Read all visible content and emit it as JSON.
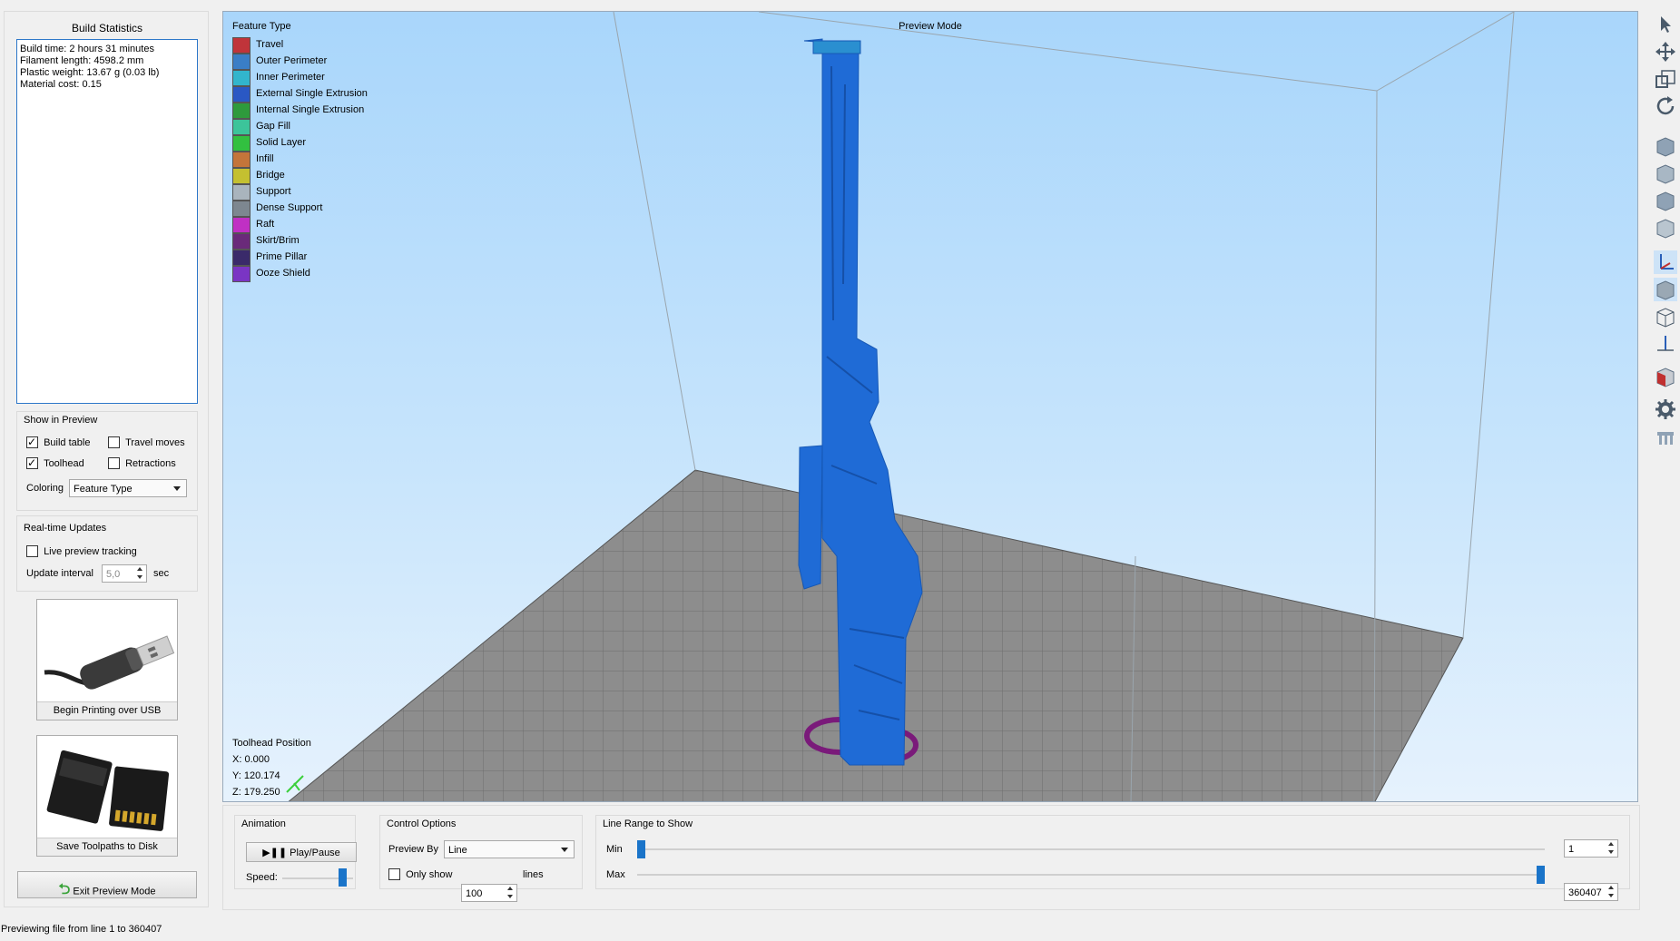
{
  "build_stats": {
    "title": "Build Statistics",
    "lines": [
      "Build time: 2 hours 31 minutes",
      "Filament length: 4598.2 mm",
      "Plastic weight: 13.67 g (0.03 lb)",
      "Material cost: 0.15"
    ]
  },
  "show_in_preview": {
    "title": "Show in Preview",
    "build_table": "Build table",
    "travel_moves": "Travel moves",
    "toolhead": "Toolhead",
    "retractions": "Retractions",
    "coloring_label": "Coloring",
    "coloring_value": "Feature Type"
  },
  "realtime": {
    "title": "Real-time Updates",
    "live_tracking": "Live preview tracking",
    "interval_label": "Update interval",
    "interval_value": "5,0",
    "interval_unit": "sec"
  },
  "actions": {
    "usb_label": "Begin Printing over USB",
    "disk_label": "Save Toolpaths to Disk",
    "exit_label": "Exit Preview Mode"
  },
  "viewport": {
    "mode_title": "Preview Mode",
    "legend_title": "Feature Type",
    "legend": [
      {
        "label": "Travel",
        "color": "#c0343a"
      },
      {
        "label": "Outer Perimeter",
        "color": "#3a7ec6"
      },
      {
        "label": "Inner Perimeter",
        "color": "#32b5cc"
      },
      {
        "label": "External Single Extrusion",
        "color": "#2a58c4"
      },
      {
        "label": "Internal Single Extrusion",
        "color": "#2e9a3c"
      },
      {
        "label": "Gap Fill",
        "color": "#3cc49a"
      },
      {
        "label": "Solid Layer",
        "color": "#32c040"
      },
      {
        "label": "Infill",
        "color": "#c4753a"
      },
      {
        "label": "Bridge",
        "color": "#c4c030"
      },
      {
        "label": "Support",
        "color": "#a9b4bd"
      },
      {
        "label": "Dense Support",
        "color": "#7d8790"
      },
      {
        "label": "Raft",
        "color": "#c030c4"
      },
      {
        "label": "Skirt/Brim",
        "color": "#6a2a7a"
      },
      {
        "label": "Prime Pillar",
        "color": "#3a2a6a"
      },
      {
        "label": "Ooze Shield",
        "color": "#7a35c4"
      }
    ],
    "toolhead_title": "Toolhead Position",
    "toolhead_x": "X: 0.000",
    "toolhead_y": "Y: 120.174",
    "toolhead_z": "Z: 179.250"
  },
  "animation": {
    "title": "Animation",
    "play_label": "Play/Pause",
    "speed_label": "Speed:",
    "speed_fraction": 0.9
  },
  "control": {
    "title": "Control Options",
    "preview_by_label": "Preview By",
    "preview_by_value": "Line",
    "only_show_label": "Only show",
    "only_show_value": "100",
    "lines_label": "lines"
  },
  "line_range": {
    "title": "Line Range to Show",
    "min_label": "Min",
    "max_label": "Max",
    "min_value": "1",
    "max_value": "360407",
    "min_fraction": 0.0,
    "max_fraction": 1.0
  },
  "status_bar": "Previewing file from line 1 to 360407",
  "colors": {
    "model_blue": "#1f6bd6",
    "brim_purple": "#7a1a7a",
    "bed_gray": "#8a8a8a",
    "accent": "#1a74c9"
  },
  "toolbar_icons": [
    "select-arrow-icon",
    "move-icon",
    "scale-icon",
    "rotate-icon",
    "view-front-icon",
    "view-top-icon",
    "view-side-icon",
    "view-iso-icon",
    "axes-icon",
    "solid-view-icon",
    "wireframe-icon",
    "axis-z-icon",
    "cube-red-icon",
    "settings-gear-icon",
    "bed-icon"
  ]
}
